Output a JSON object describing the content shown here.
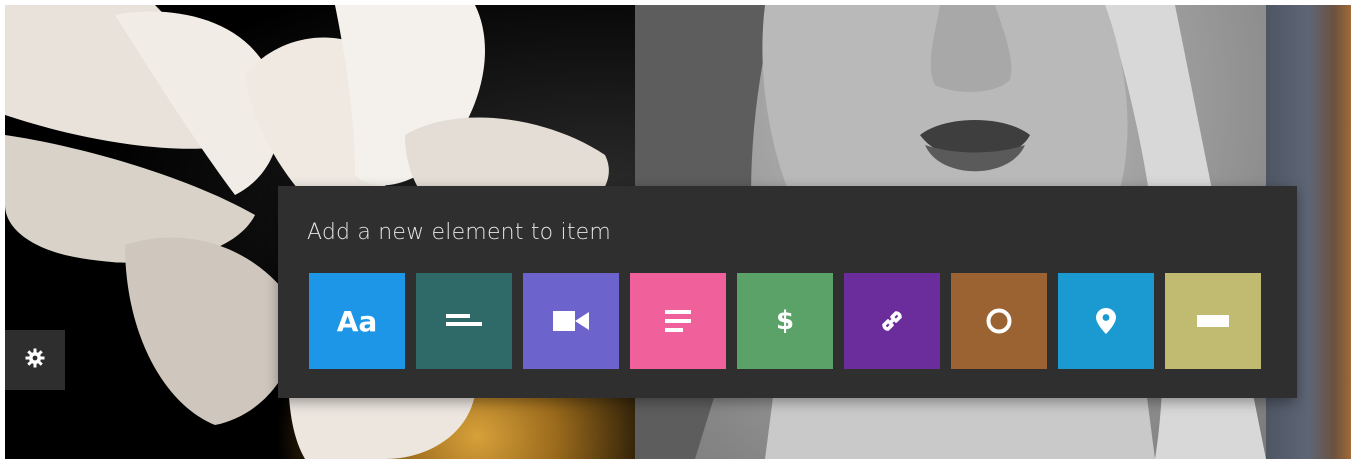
{
  "popup": {
    "title": "Add a new element to item"
  },
  "tiles": [
    {
      "name": "text",
      "label": "Aa",
      "icon": "text-aa-icon",
      "color": "#1e96e8"
    },
    {
      "name": "heading-lines",
      "icon": "lines-icon",
      "color": "#2f6a68"
    },
    {
      "name": "video",
      "icon": "video-camera-icon",
      "color": "#6c63cc"
    },
    {
      "name": "paragraph",
      "icon": "paragraph-lines-icon",
      "color": "#f0609a"
    },
    {
      "name": "price",
      "label": "$",
      "icon": "dollar-icon",
      "color": "#5aa268"
    },
    {
      "name": "link",
      "icon": "link-icon",
      "color": "#6a2d9b"
    },
    {
      "name": "circle",
      "icon": "circle-icon",
      "color": "#9a6331"
    },
    {
      "name": "location",
      "icon": "map-pin-icon",
      "color": "#1b9ad1"
    },
    {
      "name": "rectangle",
      "icon": "rectangle-icon",
      "color": "#c0bb71"
    }
  ],
  "colors": {
    "popup_bg": "#2f2f2f",
    "settings_bg": "#2e2e2e"
  },
  "settings": {
    "icon": "gear-icon"
  }
}
